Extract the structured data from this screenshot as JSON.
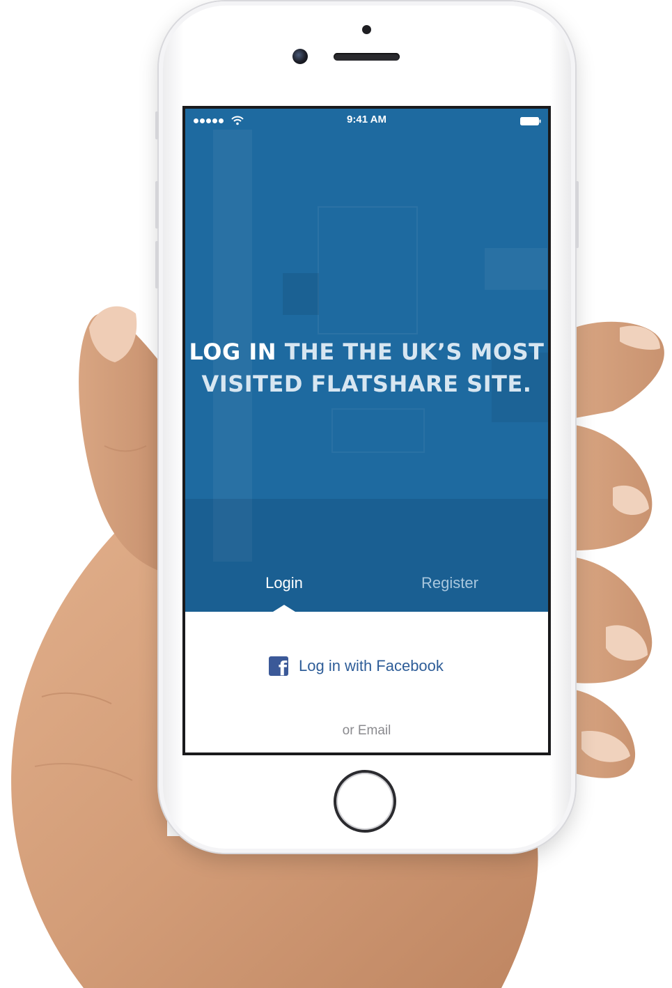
{
  "status_bar": {
    "time": "9:41 AM",
    "signal_icon": "signal-dots-icon",
    "wifi_icon": "wifi-icon",
    "battery_icon": "battery-icon"
  },
  "hero": {
    "headline_strong": "LOG IN",
    "headline_rest_line1": " THE THE UK’S MOST",
    "headline_line2": "VISITED FLATSHARE SITE.",
    "background_color": "#1e6aa0"
  },
  "tabs": [
    {
      "label": "Login",
      "active": true
    },
    {
      "label": "Register",
      "active": false
    }
  ],
  "login_panel": {
    "facebook_label": "Log in with Facebook",
    "facebook_icon": "facebook-icon",
    "facebook_color": "#3b5998",
    "or_email_label": "or Email"
  }
}
